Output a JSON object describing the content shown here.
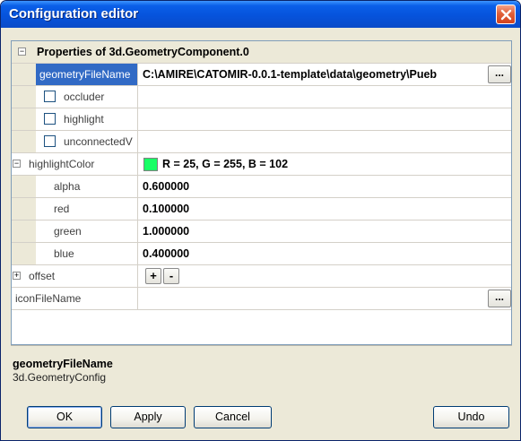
{
  "window": {
    "title": "Configuration editor"
  },
  "category": {
    "label": "Properties of 3d.GeometryComponent.0",
    "expander": "−"
  },
  "rows": {
    "geometryFileName": {
      "name": "geometryFileName",
      "value": "C:\\AMIRE\\CATOMIR-0.0.1-template\\data\\geometry\\Pueb",
      "button": "..."
    },
    "occluder": {
      "label": "occluder"
    },
    "highlight": {
      "label": "highlight"
    },
    "unconnected": {
      "label": "unconnectedV"
    },
    "highlightColor": {
      "name": "highlightColor",
      "value": "R = 25, G = 255, B = 102",
      "expander": "−",
      "swatch_color": "#19ff66"
    },
    "alpha": {
      "name": "alpha",
      "value": "0.600000"
    },
    "red": {
      "name": "red",
      "value": "0.100000"
    },
    "green": {
      "name": "green",
      "value": "1.000000"
    },
    "blue": {
      "name": "blue",
      "value": "0.400000"
    },
    "offset": {
      "name": "offset",
      "expander": "+",
      "plus": "+",
      "minus": "-"
    },
    "iconFileName": {
      "name": "iconFileName",
      "button": "..."
    }
  },
  "description": {
    "title": "geometryFileName",
    "text": "3d.GeometryConfig"
  },
  "buttons": {
    "ok": "OK",
    "apply": "Apply",
    "cancel": "Cancel",
    "undo": "Undo"
  }
}
